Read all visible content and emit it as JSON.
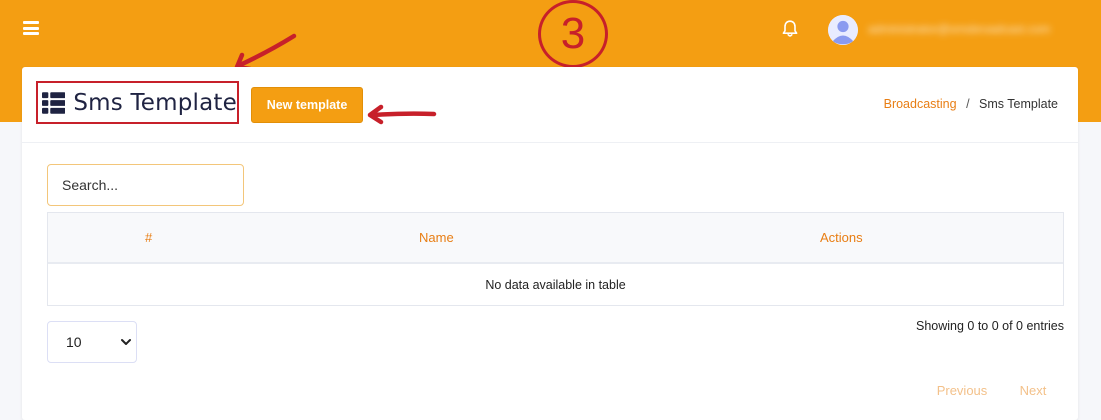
{
  "topbar": {
    "step_badge": "3",
    "user_name": "administrator@smsbroadcast.com"
  },
  "page": {
    "title": "Sms Template",
    "new_button_label": "New template"
  },
  "breadcrumb": {
    "parent": "Broadcasting",
    "separator": "/",
    "current": "Sms Template"
  },
  "search": {
    "placeholder": "Search..."
  },
  "table": {
    "columns": [
      "#",
      "Name",
      "Actions"
    ],
    "empty_message": "No data available in table"
  },
  "length": {
    "selected": "10",
    "options": [
      "10"
    ]
  },
  "info_text": "Showing 0 to 0 of 0 entries",
  "pagination": {
    "previous": "Previous",
    "next": "Next"
  },
  "colors": {
    "accent": "#f49e12",
    "annotation": "#c7202a",
    "link": "#e87e14",
    "title": "#1f2342"
  },
  "icons": {
    "menu": "hamburger-menu-icon",
    "notifications": "bell-icon",
    "avatar": "user-avatar-icon",
    "title": "table-list-icon"
  }
}
